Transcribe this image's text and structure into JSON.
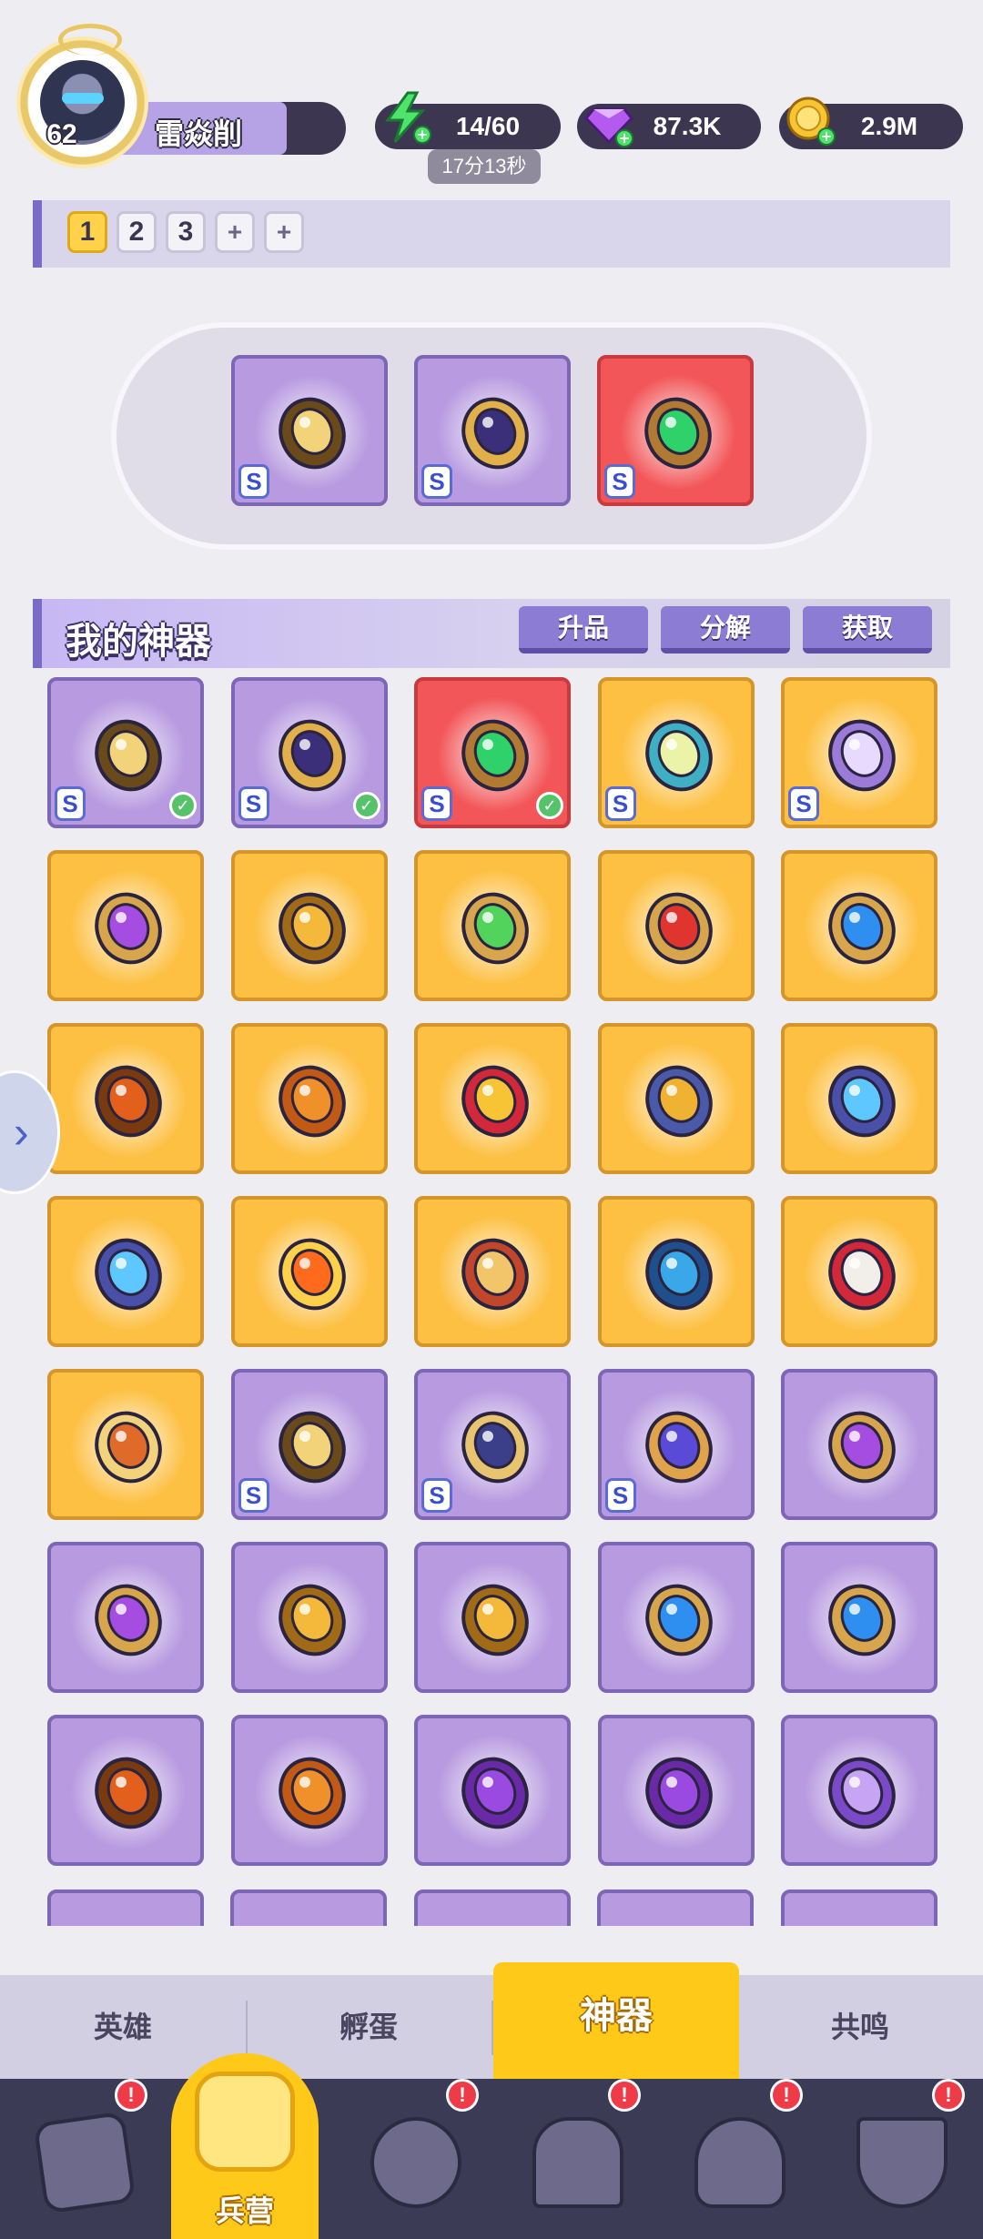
{
  "player": {
    "level": "62",
    "name": "雷焱削"
  },
  "resources": {
    "energy": {
      "icon": "lightning-icon",
      "value": "14/60",
      "timer": "17分13秒"
    },
    "gems": {
      "icon": "diamond-icon",
      "value": "87.3K"
    },
    "gold": {
      "icon": "coin-icon",
      "value": "2.9M"
    }
  },
  "presets": [
    "1",
    "2",
    "3",
    "+",
    "+"
  ],
  "active_preset": "1",
  "equipped": [
    {
      "icon": "crossbow-icon",
      "rarity": "purple",
      "badge": "S"
    },
    {
      "icon": "dark-wing-icon",
      "rarity": "purple",
      "badge": "S"
    },
    {
      "icon": "emerald-staff-icon",
      "rarity": "red",
      "badge": "S"
    }
  ],
  "my_artifacts": {
    "title": "我的神器",
    "buttons": {
      "upgrade": "升品",
      "decompose": "分解",
      "obtain": "获取"
    }
  },
  "grid": [
    {
      "icon": "crossbow-icon",
      "rarity": "purple",
      "badge": "S",
      "equipped": true
    },
    {
      "icon": "dark-wing-icon",
      "rarity": "purple",
      "badge": "S",
      "equipped": true
    },
    {
      "icon": "emerald-staff-icon",
      "rarity": "red",
      "badge": "S",
      "equipped": true
    },
    {
      "icon": "flag-icon",
      "rarity": "gold",
      "badge": "S",
      "equipped": false
    },
    {
      "icon": "crystal-orb-icon",
      "rarity": "gold",
      "badge": "S",
      "equipped": false
    },
    {
      "icon": "purple-amulet-icon",
      "rarity": "gold",
      "badge": "",
      "equipped": false
    },
    {
      "icon": "gold-amulet-icon",
      "rarity": "gold",
      "badge": "",
      "equipped": false
    },
    {
      "icon": "green-amulet-icon",
      "rarity": "gold",
      "badge": "",
      "equipped": false
    },
    {
      "icon": "red-amulet-icon",
      "rarity": "gold",
      "badge": "",
      "equipped": false
    },
    {
      "icon": "blue-amulet-icon",
      "rarity": "gold",
      "badge": "",
      "equipped": false
    },
    {
      "icon": "maple-leaf-icon",
      "rarity": "gold",
      "badge": "",
      "equipped": false
    },
    {
      "icon": "orbit-gourd-icon",
      "rarity": "gold",
      "badge": "",
      "equipped": false
    },
    {
      "icon": "crown-icon",
      "rarity": "gold",
      "badge": "",
      "equipped": false
    },
    {
      "icon": "hammer-icon",
      "rarity": "gold",
      "badge": "",
      "equipped": false
    },
    {
      "icon": "blue-flame-torch-icon",
      "rarity": "gold",
      "badge": "",
      "equipped": false
    },
    {
      "icon": "blue-flame-torch-icon",
      "rarity": "gold",
      "badge": "",
      "equipped": false
    },
    {
      "icon": "fire-torch-icon",
      "rarity": "gold",
      "badge": "",
      "equipped": false
    },
    {
      "icon": "scroll-icon",
      "rarity": "gold",
      "badge": "",
      "equipped": false
    },
    {
      "icon": "water-horn-icon",
      "rarity": "gold",
      "badge": "",
      "equipped": false
    },
    {
      "icon": "dice-icon",
      "rarity": "gold",
      "badge": "",
      "equipped": false
    },
    {
      "icon": "drum-icon",
      "rarity": "gold",
      "badge": "",
      "equipped": false
    },
    {
      "icon": "crossbow-icon",
      "rarity": "purple",
      "badge": "S",
      "equipped": false
    },
    {
      "icon": "bow-icon",
      "rarity": "purple",
      "badge": "S",
      "equipped": false
    },
    {
      "icon": "cosmic-harp-icon",
      "rarity": "purple",
      "badge": "S",
      "equipped": false
    },
    {
      "icon": "purple-amulet-icon",
      "rarity": "purple",
      "badge": "",
      "equipped": false
    },
    {
      "icon": "purple-amulet-icon",
      "rarity": "purple",
      "badge": "",
      "equipped": false
    },
    {
      "icon": "gold-amulet-icon",
      "rarity": "purple",
      "badge": "",
      "equipped": false
    },
    {
      "icon": "gold-amulet-icon",
      "rarity": "purple",
      "badge": "",
      "equipped": false
    },
    {
      "icon": "blue-amulet-icon",
      "rarity": "purple",
      "badge": "",
      "equipped": false
    },
    {
      "icon": "blue-amulet-icon",
      "rarity": "purple",
      "badge": "",
      "equipped": false
    },
    {
      "icon": "maple-leaf-icon",
      "rarity": "purple",
      "badge": "",
      "equipped": false
    },
    {
      "icon": "orbit-gourd-icon",
      "rarity": "purple",
      "badge": "",
      "equipped": false
    },
    {
      "icon": "purple-horn-icon",
      "rarity": "purple",
      "badge": "",
      "equipped": false
    },
    {
      "icon": "purple-horn-icon",
      "rarity": "purple",
      "badge": "",
      "equipped": false
    },
    {
      "icon": "purple-cloud-icon",
      "rarity": "purple",
      "badge": "",
      "equipped": false
    }
  ],
  "sub_tabs": [
    "英雄",
    "孵蛋",
    "神器",
    "共鸣"
  ],
  "active_sub_tab": "神器",
  "nav": [
    {
      "icon": "cards-icon",
      "label": "",
      "badge": "!"
    },
    {
      "icon": "barracks-icon",
      "label": "兵营",
      "badge": "",
      "active": true
    },
    {
      "icon": "map-icon",
      "label": "",
      "badge": "!"
    },
    {
      "icon": "castle-icon",
      "label": "",
      "badge": "!"
    },
    {
      "icon": "mushroom-icon",
      "label": "",
      "badge": "!"
    },
    {
      "icon": "banner-icon",
      "label": "",
      "badge": "!"
    }
  ],
  "colors": {
    "purple_card": "#b79ae0",
    "gold_card": "#fdc043",
    "red_card": "#f25658",
    "accent": "#7a6bc7",
    "active_tab": "#ffc91a"
  }
}
